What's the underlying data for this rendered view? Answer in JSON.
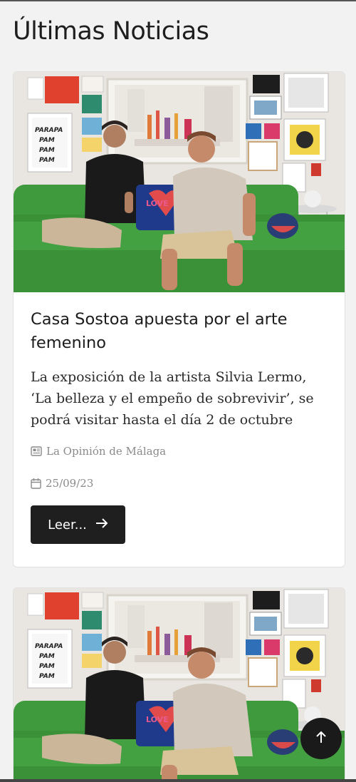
{
  "header": {
    "title": "Últimas Noticias"
  },
  "articles": [
    {
      "title": "Casa Sostoa apuesta por el arte femenino",
      "summary": "La exposición de la artista Silvia Lermo, ‘La belleza y el empeño de sobrevivir’, se podrá visitar hasta el día 2 de octubre",
      "source": "La Opinión de Málaga",
      "date": "25/09/23",
      "read_label": "Leer...",
      "image": {
        "poster_text": [
          "PARAPA",
          "PAM",
          "PAM",
          "PAM"
        ],
        "cushion_text": "LOVE"
      }
    },
    {
      "image": {
        "poster_text": [
          "PARAPA",
          "PAM",
          "PAM",
          "PAM"
        ],
        "cushion_text": "LOVE"
      }
    }
  ],
  "icons": {
    "source": "newspaper-icon",
    "date": "calendar-icon",
    "read": "arrow-right-icon",
    "scroll_top": "arrow-up-icon"
  },
  "colors": {
    "button_bg": "#1f1f1f",
    "meta_text": "#8a8a8a",
    "page_bg": "#f2f2f2"
  }
}
